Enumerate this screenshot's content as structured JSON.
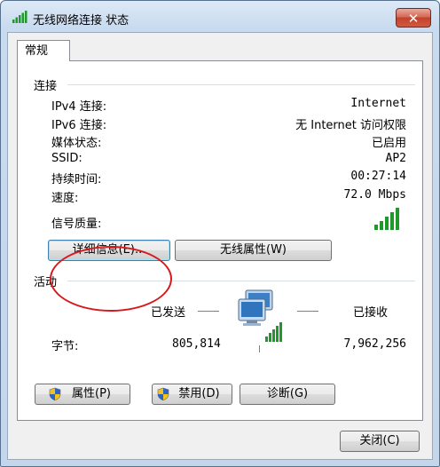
{
  "window": {
    "title": "无线网络连接 状态",
    "close_label": "✕"
  },
  "tab": {
    "label": "常规"
  },
  "connection": {
    "group_label": "连接",
    "rows": [
      {
        "label": "IPv4 连接:",
        "value": "Internet"
      },
      {
        "label": "IPv6 连接:",
        "value": "无 Internet 访问权限"
      },
      {
        "label": "媒体状态:",
        "value": "已启用"
      },
      {
        "label": "SSID:",
        "value": "AP2"
      },
      {
        "label": "持续时间:",
        "value": "00:27:14"
      },
      {
        "label": "速度:",
        "value": "72.0 Mbps"
      }
    ],
    "signal_label": "信号质量:",
    "signal_bars": 5,
    "signal_level": 5
  },
  "buttons": {
    "details": "详细信息(E)...",
    "wireless_props": "无线属性(W)"
  },
  "activity": {
    "group_label": "活动",
    "sent_label": "已发送",
    "received_label": "已接收",
    "bytes_label": "字节:",
    "sent_value": "805,814",
    "received_value": "7,962,256"
  },
  "footer_buttons": {
    "properties": "属性(P)",
    "disable": "禁用(D)",
    "diagnose": "诊断(G)"
  },
  "close_button": "关闭(C)",
  "colors": {
    "signal_green": "#1f9a2a",
    "highlight_ellipse": "#d8191c",
    "title_bg": "#c9dbef",
    "close_red": "#c2422c"
  }
}
